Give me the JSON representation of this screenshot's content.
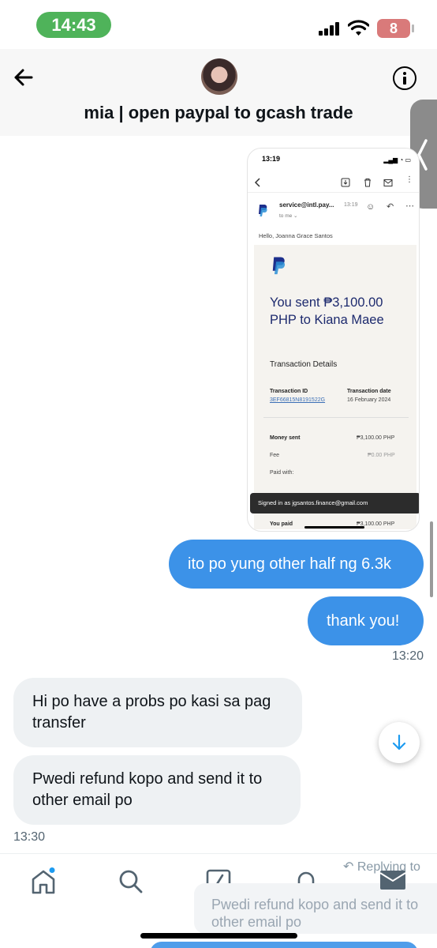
{
  "status_bar": {
    "time": "14:43",
    "battery": "8"
  },
  "header": {
    "title": "mia | open paypal to gcash trade"
  },
  "screenshot": {
    "status_time": "13:19",
    "sender": "service@intl.pay...",
    "sent_time": "13:19",
    "to_me": "to me ⌄",
    "greeting": "Hello, Joanna Grace Santos",
    "headline": "You sent ₱3,100.00 PHP to Kiana Maee",
    "section_title": "Transaction Details",
    "transaction_id_label": "Transaction ID",
    "transaction_id_value": "3EF66815N8191522G",
    "transaction_date_label": "Transaction date",
    "transaction_date_value": "16 February 2024",
    "money_sent_label": "Money sent",
    "money_sent_value": "₱3,100.00 PHP",
    "fee_label": "Fee",
    "fee_value": "₱0.00 PHP",
    "paid_with_label": "Paid with:",
    "toast": "Signed in as jgsantos.finance@gmail.com",
    "you_paid_label": "You paid",
    "you_paid_value": "₱3,100.00 PHP"
  },
  "messages": {
    "out_1": "ito po yung other half ng 6.3k",
    "out_2": "thank you!",
    "out_time": "13:20",
    "in_1": "Hi po have a probs po kasi sa pag transfer",
    "in_2": "Pwedi refund kopo and send it to other email po",
    "in_time": "13:30"
  },
  "composer": {
    "replying_to": "Replying to",
    "reply_preview": "Pwedi refund kopo and send it to other email po"
  },
  "colors": {
    "accent": "#3c92e8",
    "status_pill": "#4fb35a",
    "battery": "#d97a7a"
  }
}
